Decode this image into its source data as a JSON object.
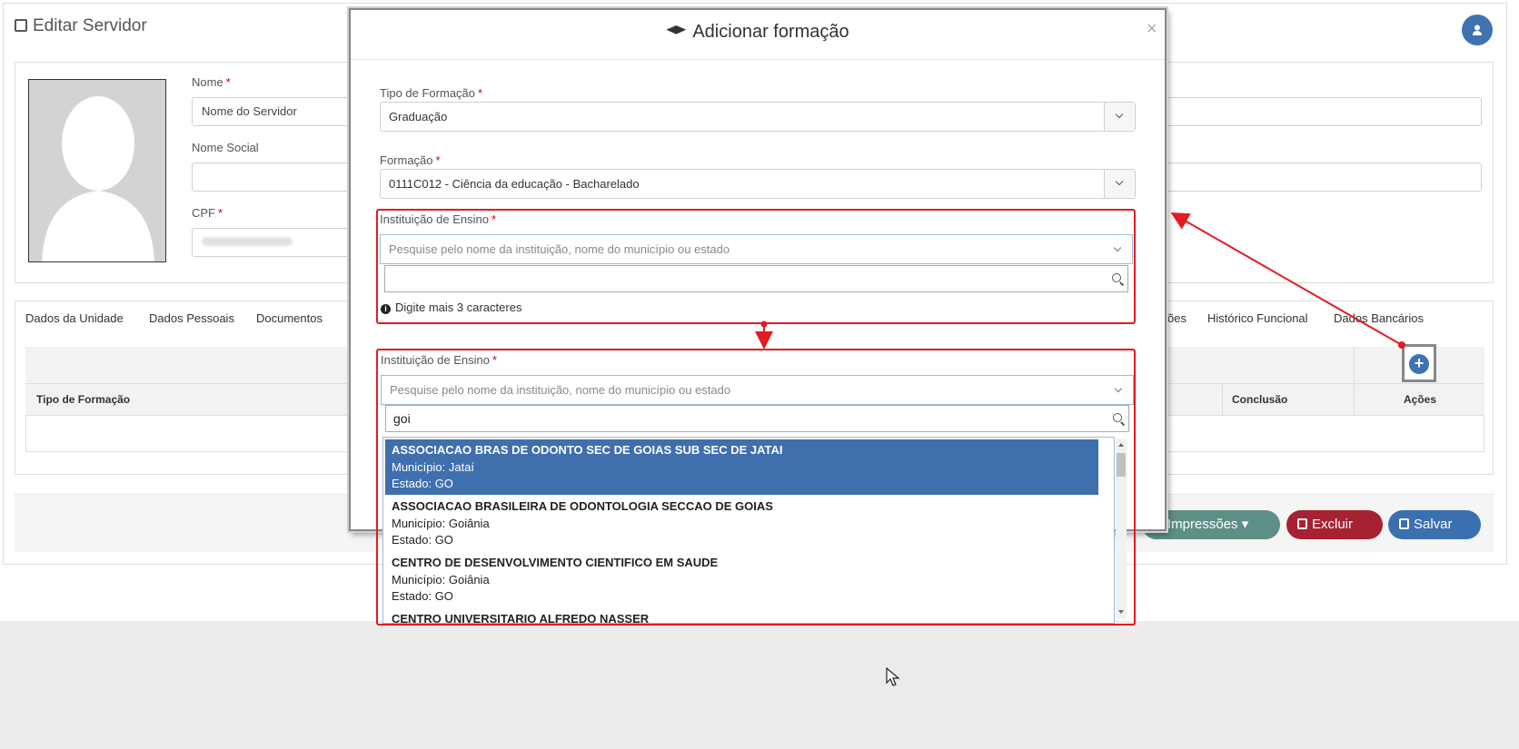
{
  "page": {
    "title": "Editar Servidor",
    "user_icon": "user-icon"
  },
  "form": {
    "nome_label": "Nome",
    "nome_value": "Nome do Servidor",
    "nome_social_label": "Nome Social",
    "nome_social_value": "",
    "cpf_label": "CPF",
    "required_mark": "*"
  },
  "tabs": {
    "dados_unidade": "Dados da Unidade",
    "dados_pessoais": "Dados Pessoais",
    "documentos": "Documentos",
    "partial": "ões",
    "historico": "Histórico Funcional",
    "bancarios": "Dados Bancários"
  },
  "table": {
    "col_tipo": "Tipo de Formação",
    "col_conclusao": "Conclusão",
    "col_acoes": "Ações"
  },
  "footer": {
    "impressoes": "Impressões",
    "excluir": "Excluir",
    "salvar": "Salvar"
  },
  "modal": {
    "title": "Adicionar formação",
    "close": "×",
    "tipo_label": "Tipo de Formação",
    "tipo_value": "Graduação",
    "formacao_label": "Formação",
    "formacao_value": "0111C012 - Ciência da educação - Bacharelado"
  },
  "step1": {
    "label": "Instituição de Ensino",
    "placeholder": "Pesquise pelo nome da instituição, nome do município ou estado",
    "search_value": "",
    "hint": "Digite mais 3 caracteres"
  },
  "step2": {
    "label": "Instituição de Ensino",
    "placeholder": "Pesquise pelo nome da instituição, nome do município ou estado",
    "search_value": "goi",
    "results": [
      {
        "name": "ASSOCIACAO BRAS DE ODONTO SEC DE GOIAS SUB SEC DE JATAI",
        "municipio": "Município: Jataí",
        "estado": "Estado: GO"
      },
      {
        "name": "ASSOCIACAO BRASILEIRA DE ODONTOLOGIA SECCAO DE GOIAS",
        "municipio": "Município: Goiânia",
        "estado": "Estado: GO"
      },
      {
        "name": "CENTRO DE DESENVOLVIMENTO CIENTIFICO EM SAUDE",
        "municipio": "Município: Goiânia",
        "estado": "Estado: GO"
      },
      {
        "name": "CENTRO UNIVERSITARIO ALFREDO NASSER",
        "municipio": "",
        "estado": ""
      }
    ]
  },
  "colors": {
    "primary": "#3f72b0",
    "danger": "#a62232",
    "print": "#5d8f86",
    "annotation": "#e31b23",
    "selected": "#3f6fad"
  }
}
